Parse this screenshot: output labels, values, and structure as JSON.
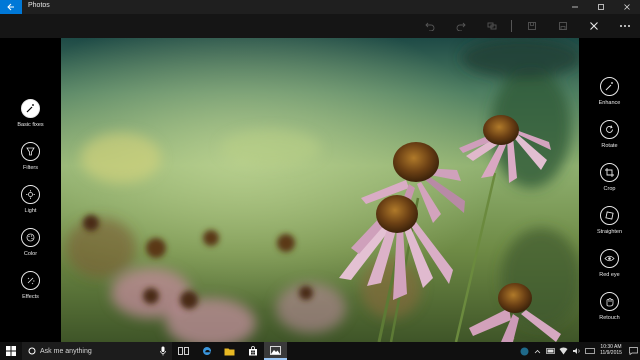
{
  "titlebar": {
    "title": "Photos",
    "back_icon": "back-arrow-icon",
    "controls": [
      "minimize-icon",
      "maximize-icon",
      "close-icon"
    ]
  },
  "commandbar": {
    "icons": [
      "undo-icon",
      "redo-icon",
      "compare-icon",
      "copy-icon",
      "save-icon",
      "close-icon",
      "more-icon"
    ]
  },
  "left_tools": [
    {
      "label": "Basic fixes",
      "icon": "magic-wand-icon",
      "active": true
    },
    {
      "label": "Filters",
      "icon": "filter-icon",
      "active": false
    },
    {
      "label": "Light",
      "icon": "light-icon",
      "active": false
    },
    {
      "label": "Color",
      "icon": "color-palette-icon",
      "active": false
    },
    {
      "label": "Effects",
      "icon": "effects-icon",
      "active": false
    }
  ],
  "right_tools": [
    {
      "label": "Enhance",
      "icon": "enhance-icon"
    },
    {
      "label": "Rotate",
      "icon": "rotate-icon"
    },
    {
      "label": "Crop",
      "icon": "crop-icon"
    },
    {
      "label": "Straighten",
      "icon": "straighten-icon"
    },
    {
      "label": "Red eye",
      "icon": "red-eye-icon"
    },
    {
      "label": "Retouch",
      "icon": "retouch-icon"
    }
  ],
  "taskbar": {
    "search_placeholder": "Ask me anything",
    "clock_time": "10:30 AM",
    "clock_date": "11/9/2015",
    "apps": [
      "microphone-icon",
      "task-view-icon",
      "edge-icon",
      "file-explorer-icon",
      "store-icon",
      "photos-app-icon"
    ]
  },
  "colors": {
    "accent": "#0078d7",
    "titlebar": "#1f1f1f",
    "commandbar": "#151515",
    "taskbar": "#101010"
  }
}
